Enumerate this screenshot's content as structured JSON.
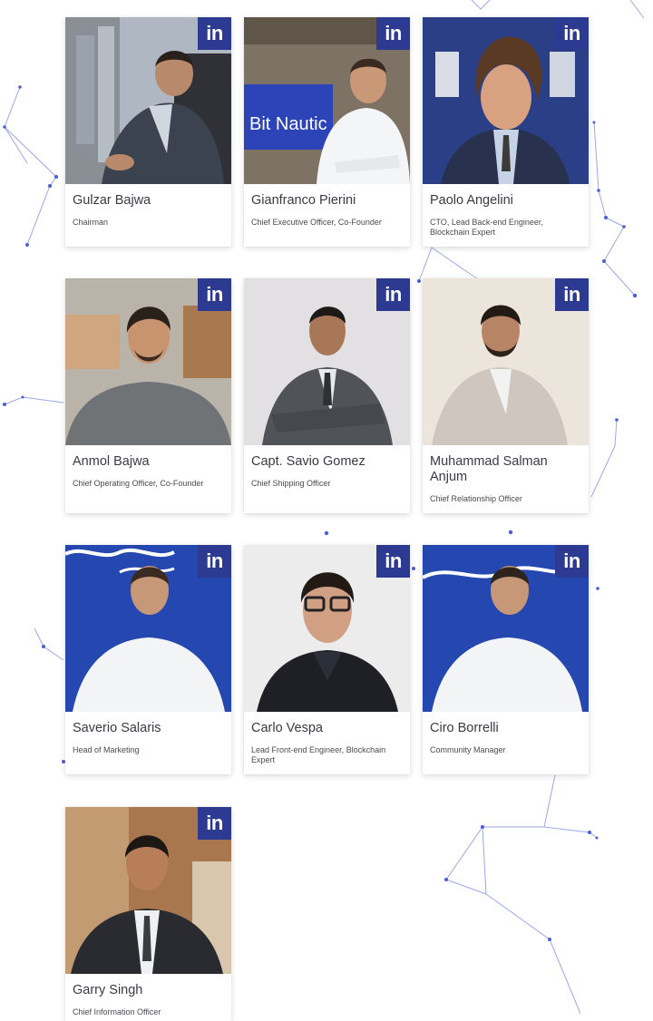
{
  "theme": {
    "accent": "#2c3a91",
    "network": "#4a5fd6",
    "name_color": "#3a3a44"
  },
  "icons": {
    "social": "linkedin-icon",
    "social_text": "in"
  },
  "team": [
    {
      "name": "Gulzar Bajwa",
      "role": "Chairman",
      "photo": "portrait-gulzar-bajwa"
    },
    {
      "name": "Gianfranco Pierini",
      "role": "Chief Executive Officer, Co-Founder",
      "photo": "portrait-gianfranco-pierini",
      "backdrop_text": "Bit Nautic"
    },
    {
      "name": "Paolo Angelini",
      "role": "CTO, Lead Back-end Engineer, Blockchain Expert",
      "photo": "portrait-paolo-angelini"
    },
    {
      "name": "Anmol Bajwa",
      "role": "Chief Operating Officer, Co-Founder",
      "photo": "portrait-anmol-bajwa"
    },
    {
      "name": "Capt. Savio Gomez",
      "role": "Chief Shipping Officer",
      "photo": "portrait-savio-gomez"
    },
    {
      "name": "Muhammad Salman Anjum",
      "role": "Chief Relationship Officer",
      "photo": "portrait-muhammad-salman-anjum"
    },
    {
      "name": "Saverio Salaris",
      "role": "Head of Marketing",
      "photo": "portrait-saverio-salaris"
    },
    {
      "name": "Carlo Vespa",
      "role": "Lead Front-end Engineer, Blockchain Expert",
      "photo": "portrait-carlo-vespa"
    },
    {
      "name": "Ciro Borrelli",
      "role": "Community Manager",
      "photo": "portrait-ciro-borrelli"
    },
    {
      "name": "Garry Singh",
      "role": "Chief Information Officer",
      "photo": "portrait-garry-singh"
    }
  ]
}
